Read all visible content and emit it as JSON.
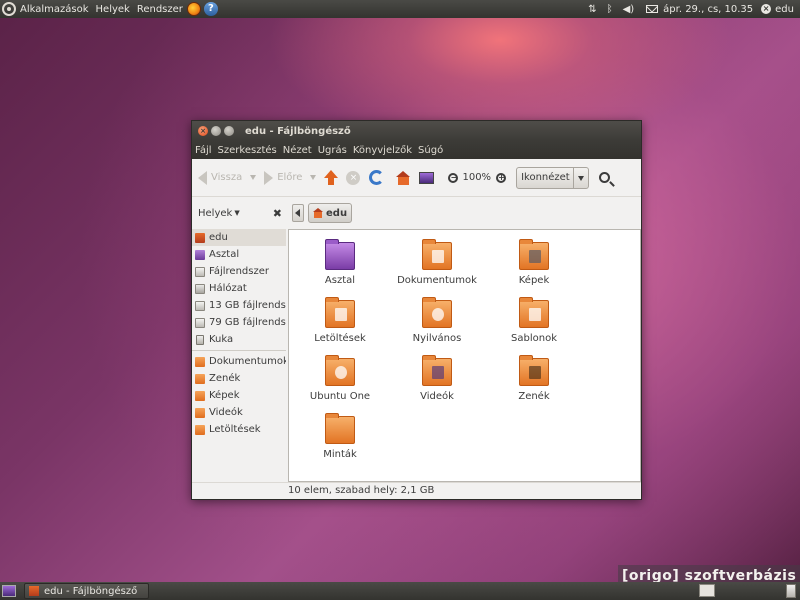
{
  "top_panel": {
    "menus": [
      "Alkalmazások",
      "Helyek",
      "Rendszer"
    ],
    "tray_icons": [
      "network-icon",
      "bluetooth-icon",
      "volume-icon",
      "mail-icon"
    ],
    "clock": "ápr. 29., cs, 10.35",
    "user": "edu"
  },
  "window": {
    "title": "edu - Fájlböngésző",
    "menu": [
      "Fájl",
      "Szerkesztés",
      "Nézet",
      "Ugrás",
      "Könyvjelzők",
      "Súgó"
    ],
    "toolbar": {
      "back": "Vissza",
      "forward": "Előre",
      "zoom": "100%",
      "view_mode": "Ikonnézet"
    },
    "sidebar": {
      "header": "Helyek",
      "places": [
        "edu",
        "Asztal",
        "Fájlrendszer",
        "Hálózat",
        "13 GB fájlrends...",
        "79 GB fájlrends...",
        "Kuka"
      ],
      "bookmarks": [
        "Dokumentumok",
        "Zenék",
        "Képek",
        "Videók",
        "Letöltések"
      ]
    },
    "path": "edu",
    "files": [
      "Asztal",
      "Dokumentumok",
      "Képek",
      "Letöltések",
      "Nyilvános",
      "Sablonok",
      "Ubuntu One",
      "Videók",
      "Zenék",
      "Minták"
    ],
    "status": "10 elem, szabad hely: 2,1 GB"
  },
  "bottom_panel": {
    "task": "edu - Fájlböngésző"
  },
  "watermark": "[origo] szoftverbázis",
  "colors": {
    "folder_orange": "#e27424",
    "panel_dark": "#3c3b37",
    "wallpaper_purple": "#7a3566"
  }
}
